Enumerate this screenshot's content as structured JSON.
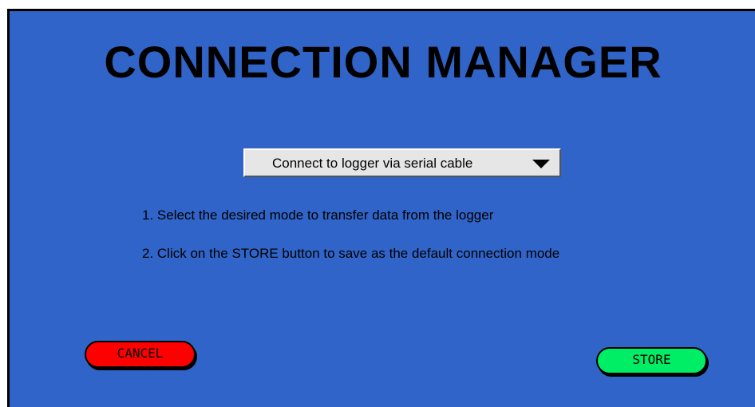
{
  "window": {
    "title": "CONNECTION MANAGER"
  },
  "mode_select": {
    "selected": "Connect to logger via serial cable",
    "arrow_icon": "triangle-down-icon"
  },
  "instructions": {
    "step1": "1.  Select the desired mode to transfer data from the logger",
    "step2": "2.  Click on the STORE button to save as the default connection mode"
  },
  "buttons": {
    "cancel_label": "CANCEL",
    "store_label": "STORE"
  },
  "colors": {
    "background": "#3164c8",
    "cancel": "#ff0000",
    "store": "#00ee66"
  }
}
